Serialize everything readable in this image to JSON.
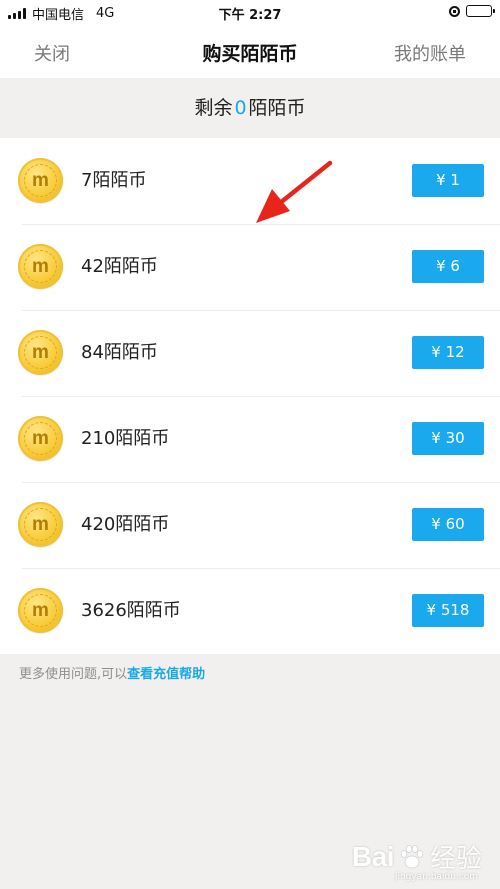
{
  "status_bar": {
    "carrier": "中国电信",
    "network": "4G",
    "time": "下午 2:27",
    "icons": [
      "signal-icon",
      "rotation-lock-icon",
      "battery-icon"
    ]
  },
  "nav": {
    "close_label": "关闭",
    "title": "购买陌陌币",
    "bill_label": "我的账单"
  },
  "balance": {
    "prefix": "剩余",
    "value": "0",
    "suffix": "陌陌币"
  },
  "packages": [
    {
      "amount": "7陌陌币",
      "price": "¥ 1"
    },
    {
      "amount": "42陌陌币",
      "price": "¥ 6"
    },
    {
      "amount": "84陌陌币",
      "price": "¥ 12"
    },
    {
      "amount": "210陌陌币",
      "price": "¥ 30"
    },
    {
      "amount": "420陌陌币",
      "price": "¥ 60"
    },
    {
      "amount": "3626陌陌币",
      "price": "¥ 518"
    }
  ],
  "coin_icon": {
    "letter": "m",
    "icon": "coin-icon"
  },
  "help": {
    "text": "更多使用问题,可以",
    "link": "查看充值帮助"
  },
  "watermark": {
    "brand": "Bai",
    "sub": "经验",
    "url": "jingyan.baidu.com"
  },
  "colors": {
    "accent": "#19a9ec",
    "background": "#f1f0ee",
    "coin": "#f7cb3a",
    "annotation": "#e8251b"
  }
}
